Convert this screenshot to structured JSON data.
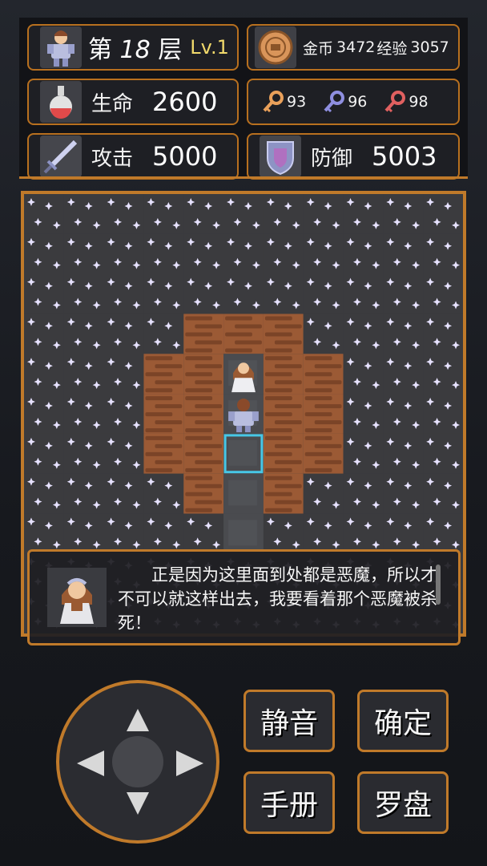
{
  "hud": {
    "floor_prefix": "第",
    "floor_number": "18",
    "floor_suffix": "层",
    "level": "Lv.1",
    "gold_label": "金币",
    "gold_value": "3472",
    "exp_label": "经验",
    "exp_value": "3057",
    "hp_label": "生命",
    "hp_value": "2600",
    "atk_label": "攻击",
    "atk_value": "5000",
    "def_label": "防御",
    "def_value": "5003",
    "keys": [
      {
        "name": "yellow-key-icon",
        "count": "93",
        "color": "#e9a05a"
      },
      {
        "name": "blue-key-icon",
        "count": "96",
        "color": "#8f8fe0"
      },
      {
        "name": "red-key-icon",
        "count": "98",
        "color": "#e06060"
      }
    ],
    "accent": "#c07a2a"
  },
  "board": {
    "grid_size": 11,
    "tiles": [
      "SSSSSSSSSSS",
      "SSSSSSSSSSS",
      "SSSSSSSSSSS",
      "SSSSWWWSSSS",
      "SSSWWFWWSSS",
      "SSSWWFWWSSS",
      "SSSWWFWWSSS",
      "SSSSWFWSSSS",
      "SSSSSFSSSSS",
      "SSSSSSSSSSS",
      "SSSSSSSSSSS"
    ],
    "colors": {
      "star_bg": "#3b3b3e",
      "star": "#e7e2ff",
      "wall": "#9b5a35",
      "wall_dark": "#6e3b22",
      "floor": "#4a4b4f",
      "highlight": "#47c7e6"
    }
  },
  "dialog": {
    "text": "正是因为这里面到处都是恶魔，所以才不可以就这样出去，我要看着那个恶魔被杀死！"
  },
  "controls": {
    "mute": "静音",
    "confirm": "确定",
    "manual": "手册",
    "compass": "罗盘"
  }
}
